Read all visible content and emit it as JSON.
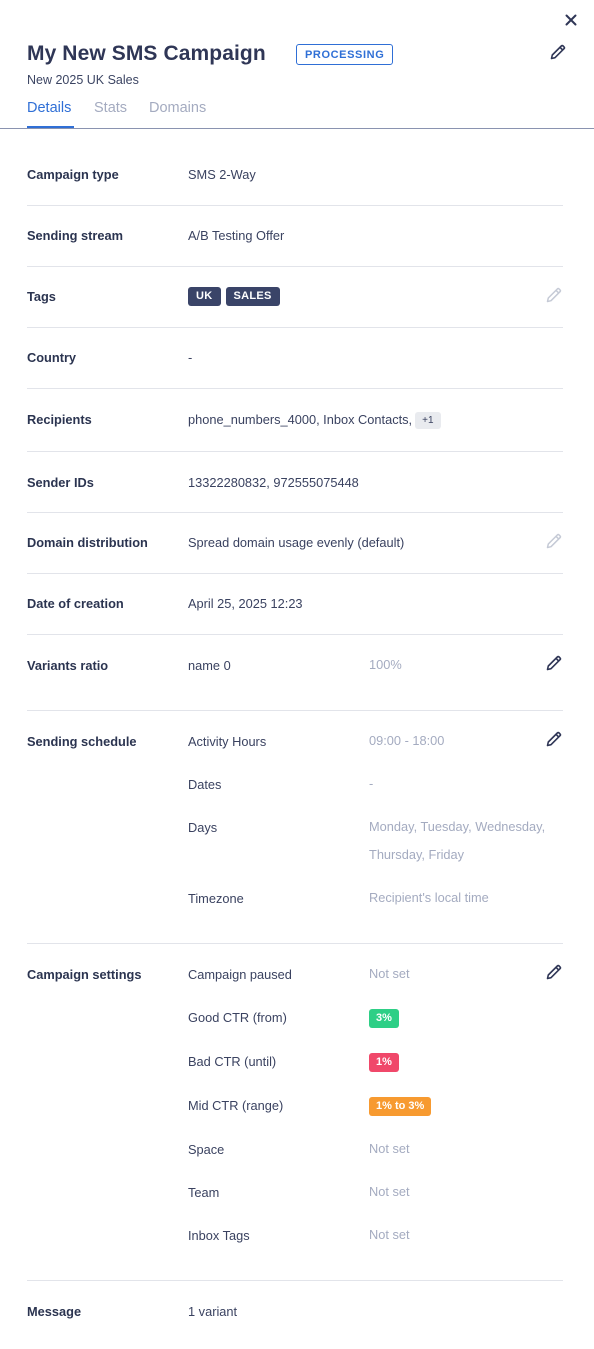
{
  "header": {
    "title": "My New SMS Campaign",
    "status": "PROCESSING",
    "subtitle": "New 2025 UK Sales"
  },
  "tabs": [
    {
      "label": "Details",
      "active": true
    },
    {
      "label": "Stats",
      "active": false
    },
    {
      "label": "Domains",
      "active": false
    }
  ],
  "details": {
    "campaign_type": {
      "label": "Campaign type",
      "value": "SMS 2-Way"
    },
    "sending_stream": {
      "label": "Sending stream",
      "value": "A/B Testing Offer"
    },
    "tags": {
      "label": "Tags",
      "items": [
        "UK",
        "SALES"
      ]
    },
    "country": {
      "label": "Country",
      "value": "-"
    },
    "recipients": {
      "label": "Recipients",
      "value": "phone_numbers_4000, Inbox Contacts,",
      "more": "+1"
    },
    "sender_ids": {
      "label": "Sender IDs",
      "value": "13322280832, 972555075448"
    },
    "domain_distribution": {
      "label": "Domain distribution",
      "value": "Spread domain usage evenly (default)"
    },
    "date_of_creation": {
      "label": "Date of creation",
      "value": "April 25, 2025 12:23"
    },
    "variants_ratio": {
      "label": "Variants ratio",
      "name": "name 0",
      "value": "100%"
    },
    "sending_schedule": {
      "label": "Sending schedule",
      "items": [
        {
          "label": "Activity Hours",
          "value": "09:00 - 18:00"
        },
        {
          "label": "Dates",
          "value": "-"
        },
        {
          "label": "Days",
          "value": "Monday, Tuesday, Wednesday, Thursday, Friday"
        },
        {
          "label": "Timezone",
          "value": "Recipient's local time"
        }
      ]
    },
    "campaign_settings": {
      "label": "Campaign settings",
      "items": [
        {
          "label": "Campaign paused",
          "value": "Not set"
        },
        {
          "label": "Good CTR (from)",
          "value": "3%",
          "color": "#2ecf86"
        },
        {
          "label": "Bad CTR (until)",
          "value": "1%",
          "color": "#f0486a"
        },
        {
          "label": "Mid CTR (range)",
          "value": "1% to 3%",
          "color": "#f79a30"
        },
        {
          "label": "Space",
          "value": "Not set"
        },
        {
          "label": "Team",
          "value": "Not set"
        },
        {
          "label": "Inbox Tags",
          "value": "Not set"
        }
      ]
    },
    "message": {
      "label": "Message",
      "value": "1 variant"
    }
  },
  "colors": {
    "accent": "#2f6fd6",
    "tag_bg": "#3a4468",
    "muted": "#a4abc0"
  },
  "icons": {
    "close": "close-icon",
    "edit": "pencil-icon"
  }
}
